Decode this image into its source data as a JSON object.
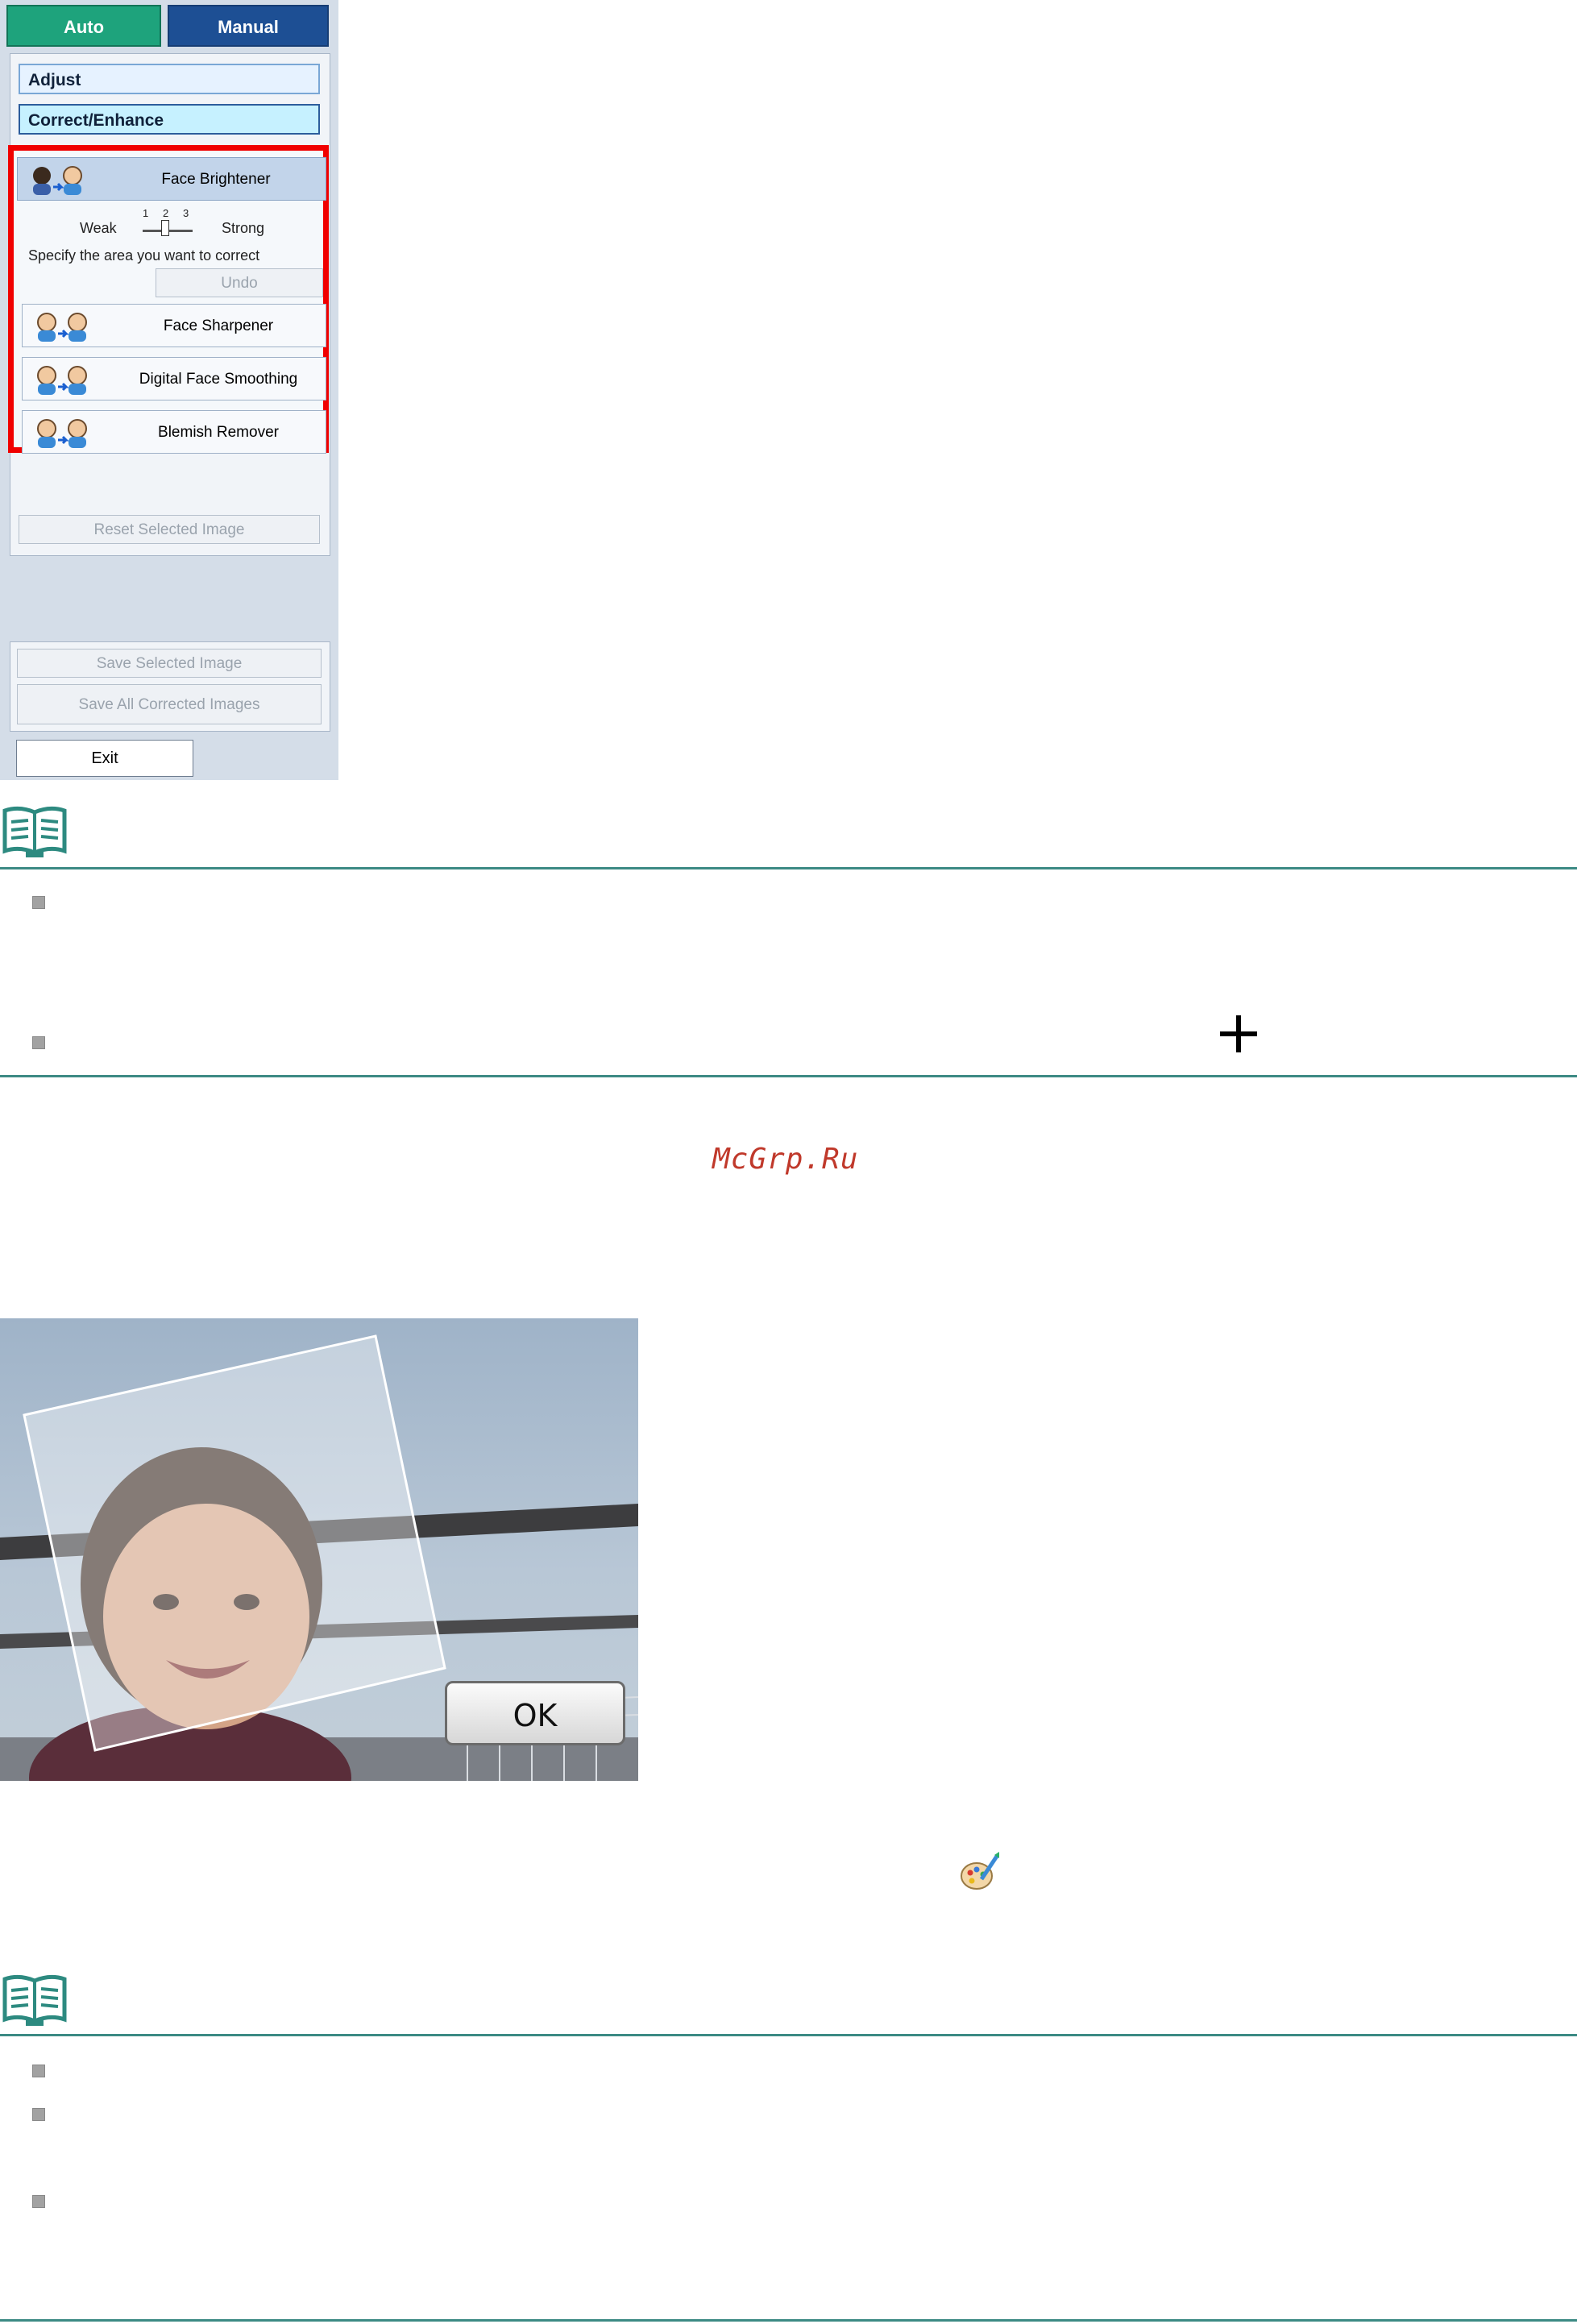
{
  "panel": {
    "tabs": {
      "auto": "Auto",
      "manual": "Manual"
    },
    "sections": {
      "adjust": "Adjust",
      "correct": "Correct/Enhance"
    },
    "tools": {
      "face_brightener": "Face Brightener",
      "face_sharpener": "Face Sharpener",
      "digital_face_smoothing": "Digital Face Smoothing",
      "blemish_remover": "Blemish Remover"
    },
    "slider": {
      "weak": "Weak",
      "strong": "Strong",
      "ticks": [
        "1",
        "2",
        "3"
      ],
      "level": 2
    },
    "instruction": "Specify the area you want to correct",
    "buttons": {
      "undo": "Undo",
      "reset": "Reset Selected Image",
      "save_selected": "Save Selected Image",
      "save_all": "Save All Corrected Images",
      "exit": "Exit"
    },
    "colors": {
      "highlight_border": "#f00000",
      "auto_tab": "#1ea37c",
      "manual_tab": "#1d4f94"
    }
  },
  "watermark": "McGrp.Ru",
  "photo": {
    "ok": "OK"
  },
  "icons": [
    "note-book-icon",
    "plus-cursor-icon",
    "palette-brush-icon"
  ]
}
